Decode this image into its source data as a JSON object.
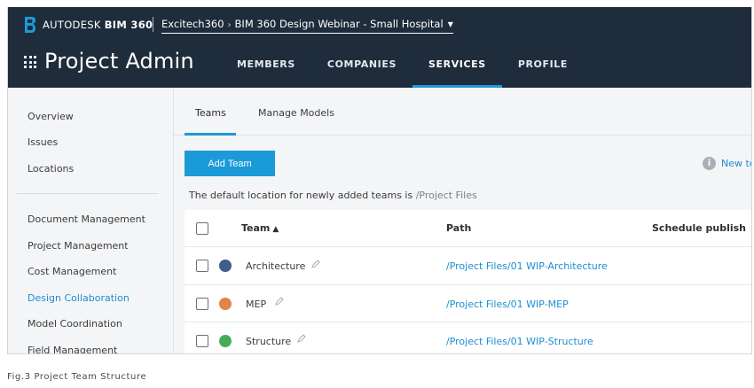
{
  "header": {
    "brand_prefix": "AUTODESK",
    "brand_product": "BIM 360",
    "breadcrumb_company": "Excitech360",
    "breadcrumb_project": "BIM 360 Design Webinar - Small Hospital",
    "page_title": "Project Admin",
    "nav": [
      {
        "label": "MEMBERS",
        "active": false
      },
      {
        "label": "COMPANIES",
        "active": false
      },
      {
        "label": "SERVICES",
        "active": true
      },
      {
        "label": "PROFILE",
        "active": false
      }
    ],
    "colors": {
      "bar": "#1f2c3b",
      "accent": "#1b9ad8"
    }
  },
  "sidebar": {
    "group1": [
      "Overview",
      "Issues",
      "Locations"
    ],
    "group2": [
      "Document Management",
      "Project Management",
      "Cost Management",
      "Design Collaboration",
      "Model Coordination",
      "Field Management"
    ],
    "active": "Design Collaboration"
  },
  "main": {
    "tabs": [
      {
        "label": "Teams",
        "active": true
      },
      {
        "label": "Manage Models",
        "active": false
      }
    ],
    "add_team_label": "Add Team",
    "info_link": "New te",
    "info_icon": "info-icon",
    "default_location_prefix": "The default location for newly added teams is ",
    "default_location_path": "/Project Files",
    "table": {
      "headers": {
        "team": "Team",
        "path": "Path",
        "schedule": "Schedule publish"
      },
      "rows": [
        {
          "name": "Architecture",
          "color": "#3f5d8a",
          "path": "/Project Files/01 WIP-Architecture"
        },
        {
          "name": "MEP",
          "color": "#e0844a",
          "path": "/Project Files/01 WIP-MEP"
        },
        {
          "name": "Structure",
          "color": "#44ad5b",
          "path": "/Project Files/01 WIP-Structure"
        }
      ]
    }
  },
  "caption": "Fig.3 Project Team Structure"
}
